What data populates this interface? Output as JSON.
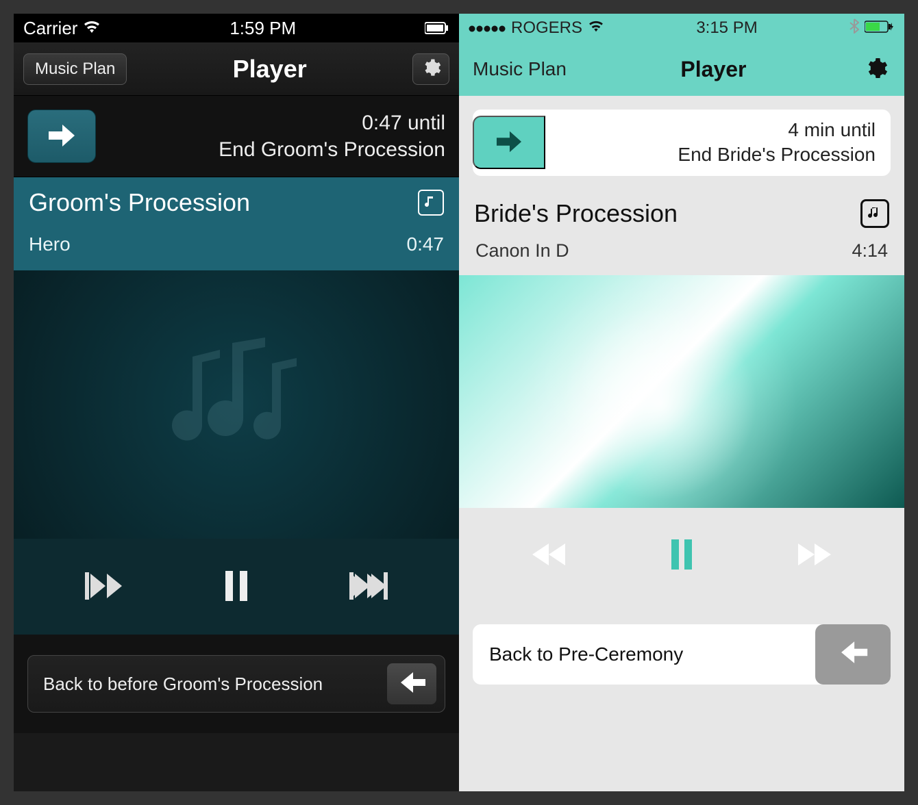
{
  "left": {
    "statusbar": {
      "carrier": "Carrier",
      "time": "1:59 PM"
    },
    "navbar": {
      "back_label": "Music Plan",
      "title": "Player"
    },
    "next": {
      "time_until": "0:47 until",
      "event": "End Groom's Procession"
    },
    "section": {
      "title": "Groom's Procession"
    },
    "song": {
      "name": "Hero",
      "duration": "0:47"
    },
    "back": {
      "label": "Back to before Groom's Procession"
    }
  },
  "right": {
    "statusbar": {
      "carrier": "ROGERS",
      "time": "3:15 PM"
    },
    "navbar": {
      "back_label": "Music Plan",
      "title": "Player"
    },
    "next": {
      "time_until": "4 min until",
      "event": "End Bride's Procession"
    },
    "section": {
      "title": "Bride's Procession"
    },
    "song": {
      "name": "Canon In D",
      "duration": "4:14"
    },
    "back": {
      "label": "Back to Pre-Ceremony"
    }
  }
}
